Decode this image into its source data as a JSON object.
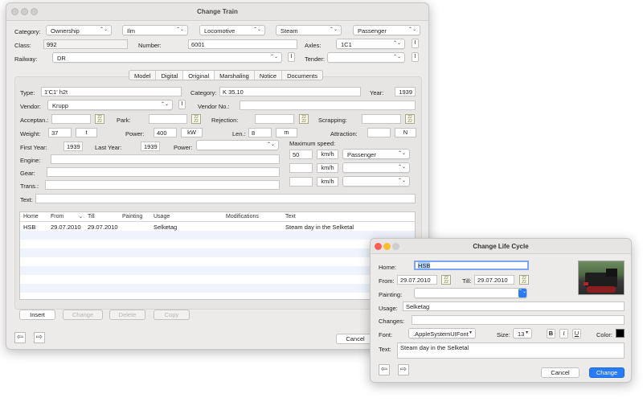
{
  "main": {
    "title": "Change Train",
    "category_label": "Category:",
    "category_popups": [
      "Ownership",
      "Ilm",
      "Locomotive",
      "Steam",
      "Passenger"
    ],
    "class_label": "Class:",
    "class_value": "992",
    "number_label": "Number:",
    "number_value": "6001",
    "axles_label": "Axles:",
    "axles_value": "1C1",
    "railway_label": "Railway:",
    "railway_value": "DR",
    "tender_label": "Tender:",
    "tender_value": "",
    "i_label": "I",
    "tabs": [
      "Model",
      "Digital",
      "Original",
      "Marshaling",
      "Notice",
      "Documents"
    ],
    "selected_tab": "Original",
    "original": {
      "type_label": "Type:",
      "type_value": "1'C1' h2t",
      "category_label": "Category:",
      "category_value": "K 35.10",
      "year_label": "Year:",
      "year_value": "1939",
      "vendor_label": "Vendor:",
      "vendor_value": "Krupp",
      "vendor_no_label": "Vendor No.:",
      "vendor_no_value": "",
      "acceptan_label": "Acceptan.:",
      "park_label": "Park:",
      "rejection_label": "Rejection:",
      "scrapping_label": "Scrapping:",
      "weight_label": "Weight:",
      "weight_value": "37",
      "weight_unit": "t",
      "power_label": "Power:",
      "power_value": "400",
      "power_unit": "kW",
      "len_label": "Len.:",
      "len_value": "8",
      "len_unit": "m",
      "attraction_label": "Attraction:",
      "attraction_value": "",
      "attraction_unit": "N",
      "first_year_label": "First Year:",
      "first_year_value": "1939",
      "last_year_label": "Last Year:",
      "last_year_value": "1939",
      "power2_label": "Power:",
      "power2_value": "",
      "max_speed_label": "Maximum speed:",
      "speeds": [
        {
          "value": "50",
          "unit": "km/h",
          "kind": "Passenger"
        },
        {
          "value": "",
          "unit": "km/h",
          "kind": ""
        },
        {
          "value": "",
          "unit": "km/h",
          "kind": ""
        }
      ],
      "engine_label": "Engine:",
      "gear_label": "Gear:",
      "trans_label": "Trans.:",
      "text_label": "Text:"
    },
    "table": {
      "headers": [
        "Home",
        "From",
        "Till",
        "Painting",
        "Usage",
        "Modifications",
        "Text"
      ],
      "rows": [
        {
          "home": "HSB",
          "from": "29.07.2010",
          "till": "29.07.2010",
          "painting": "",
          "usage": "Selketag",
          "modifications": "",
          "text": "Steam day in the Selketal"
        }
      ]
    },
    "buttons": {
      "insert": "Insert",
      "change": "Change",
      "delete": "Delete",
      "copy": "Copy",
      "cancel": "Cancel"
    }
  },
  "dialog": {
    "title": "Change Life Cycle",
    "home_label": "Home:",
    "home_value": "HSB",
    "from_label": "From:",
    "from_value": "29.07.2010",
    "till_label": "Till:",
    "till_value": "29.07.2010",
    "painting_label": "Painting:",
    "usage_label": "Usage:",
    "usage_value": "Selketag",
    "changes_label": "Changes:",
    "font_label": "Font:",
    "font_value": ".AppleSystemUIFont",
    "size_label": "Size:",
    "size_value": "13",
    "bold": "B",
    "italic": "I",
    "underline": "U",
    "color_label": "Color:",
    "text_label": "Text:",
    "text_value": "Steam day in the Selketal",
    "cancel": "Cancel",
    "change": "Change"
  },
  "colors": {
    "accent": "#2a7cf6",
    "row_alt": "#eef3fc",
    "close": "#fe5f57",
    "minimize": "#febc2e",
    "zoom": "#28c840"
  }
}
